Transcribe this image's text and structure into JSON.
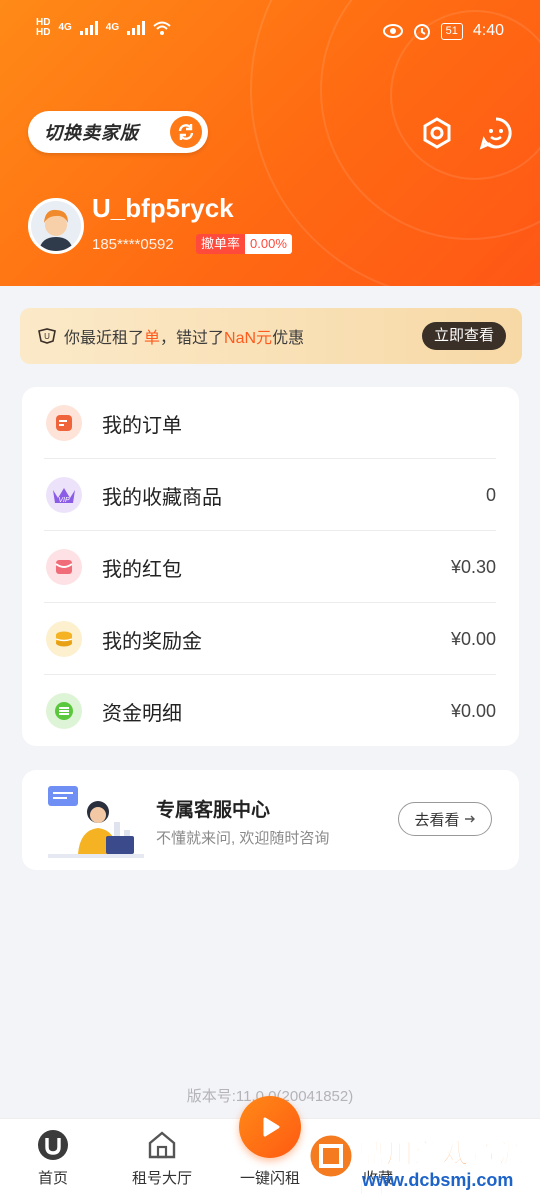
{
  "status_bar": {
    "left_signal_1": "4G",
    "left_signal_2": "4G",
    "battery": "51",
    "time": "4:40"
  },
  "header": {
    "switch_label": "切换卖家版",
    "username": "U_bfp5ryck",
    "phone": "185****0592",
    "rate_label": "撤单率",
    "rate_value": "0.00%"
  },
  "promo": {
    "text_1": "你最近租了",
    "highlight_1": "单",
    "text_2": "，错过了",
    "highlight_2": "NaN元",
    "text_3": "优惠",
    "button": "立即查看"
  },
  "menu": {
    "items": [
      {
        "label": "我的订单",
        "value": "",
        "icon": "order-icon",
        "color": "#f0643c"
      },
      {
        "label": "我的收藏商品",
        "value": "0",
        "icon": "vip-icon",
        "color": "#8b5ce6"
      },
      {
        "label": "我的红包",
        "value": "¥0.30",
        "icon": "red-packet-icon",
        "color": "#f06c78"
      },
      {
        "label": "我的奖励金",
        "value": "¥0.00",
        "icon": "coin-icon",
        "color": "#f5b323"
      },
      {
        "label": "资金明细",
        "value": "¥0.00",
        "icon": "list-icon",
        "color": "#5ac83c"
      }
    ]
  },
  "service": {
    "title": "专属客服中心",
    "subtitle": "不懂就来问, 欢迎随时咨询",
    "button": "去看看"
  },
  "version": "版本号:11.0.0(20041852)",
  "tabbar": {
    "tabs": [
      {
        "label": "首页"
      },
      {
        "label": "租号大厅"
      },
      {
        "label": "一键闪租"
      },
      {
        "label": "收藏"
      }
    ]
  },
  "watermark": {
    "text": "鼎川游戏资源网",
    "url": "www.dcbsmj.com"
  }
}
